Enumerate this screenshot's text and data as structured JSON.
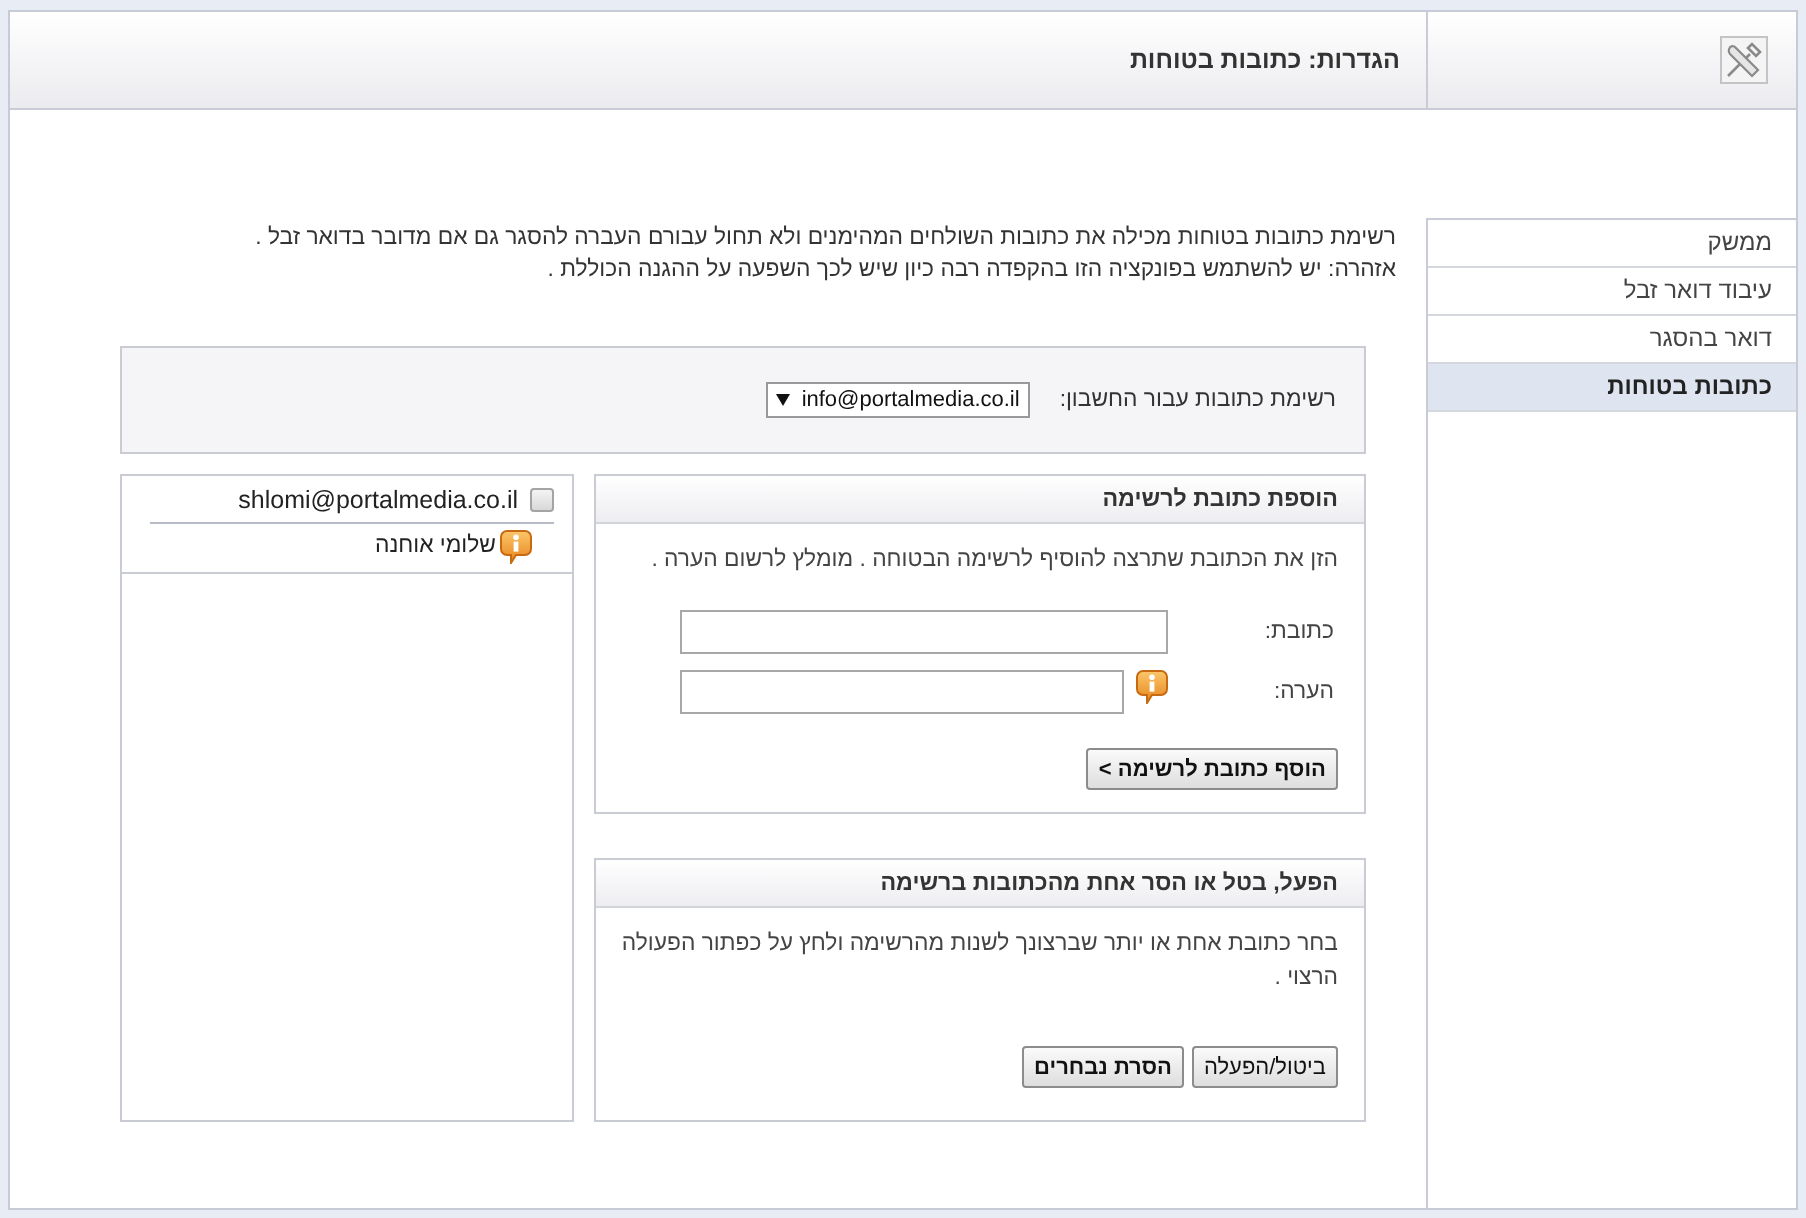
{
  "header": {
    "title": "הגדרות: כתובות בטוחות"
  },
  "sidebar": {
    "items": [
      {
        "label": "ממשק",
        "selected": false
      },
      {
        "label": "עיבוד דואר זבל",
        "selected": false
      },
      {
        "label": "דואר בהסגר",
        "selected": false
      },
      {
        "label": "כתובות בטוחות",
        "selected": true
      }
    ]
  },
  "description": [
    "רשימת כתובות בטוחות מכילה את כתובות השולחים המהימנים ולא תחול עבורם העברה להסגר גם אם מדובר בדואר זבל .",
    "אזהרה: יש להשתמש בפונקציה הזו בהקפדה רבה כיון שיש לכך השפעה על ההגנה הכוללת ."
  ],
  "account": {
    "label": "רשימת כתובות עבור החשבון:",
    "value": "info@portalmedia.co.il"
  },
  "safe_list": {
    "entries": [
      {
        "address": "shlomi@portalmedia.co.il",
        "checked": false,
        "note": "שלומי אוחנה"
      }
    ]
  },
  "add_panel": {
    "title": "הוספת כתובת לרשימה",
    "hint": "הזן את הכתובת שתרצה להוסיף לרשימה הבטוחה . מומלץ לרשום הערה .",
    "fields": [
      {
        "kind": "plain",
        "label": "כתובת:"
      },
      {
        "kind": "with_info",
        "label": "הערה:"
      }
    ],
    "buttons": [
      {
        "kind": "primary",
        "label": "הוסף כתובת לרשימה >"
      }
    ]
  },
  "action_panel": {
    "title": "הפעל, בטל או הסר אחת מהכתובות ברשימה",
    "hint": "בחר כתובת אחת או יותר שברצונך לשנות מהרשימה ולחץ על כפתור הפעולה הרצוי .",
    "buttons": [
      {
        "kind": "default",
        "label": "ביטול/הפעלה"
      },
      {
        "kind": "primary",
        "label": "הסרת נבחרים"
      }
    ]
  }
}
